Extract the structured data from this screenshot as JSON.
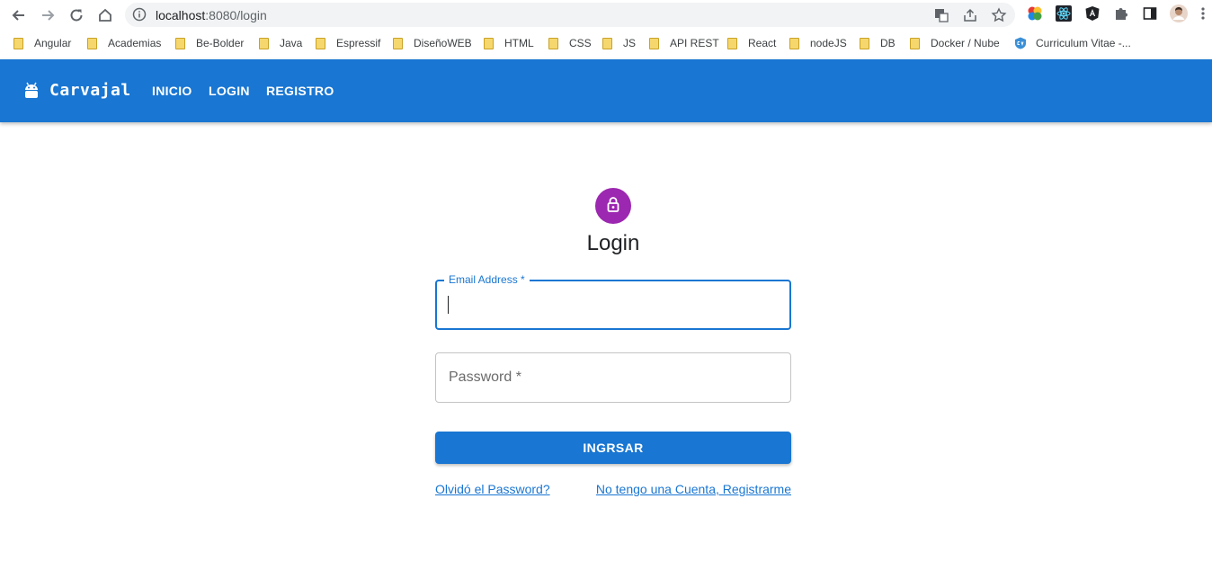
{
  "browser": {
    "url_host": "localhost",
    "url_rest": ":8080/login",
    "bookmarks": [
      {
        "label": "Angular"
      },
      {
        "label": "Academias"
      },
      {
        "label": "Be-Bolder"
      },
      {
        "label": "Java"
      },
      {
        "label": "Espressif"
      },
      {
        "label": "DiseñoWEB"
      },
      {
        "label": "HTML"
      },
      {
        "label": "CSS"
      },
      {
        "label": "JS"
      },
      {
        "label": "API REST"
      },
      {
        "label": "React"
      },
      {
        "label": "nodeJS"
      },
      {
        "label": "DB"
      },
      {
        "label": "Docker / Nube"
      },
      {
        "label": "Curriculum Vitae -..."
      }
    ]
  },
  "app": {
    "brand": "Carvajal",
    "nav": [
      {
        "label": "INICIO"
      },
      {
        "label": "LOGIN"
      },
      {
        "label": "REGISTRO"
      }
    ]
  },
  "login": {
    "title": "Login",
    "email_label": "Email Address *",
    "email_value": "",
    "password_placeholder": "Password *",
    "submit_label": "INGRSAR",
    "forgot_link": "Olvidó el Password?",
    "register_link": "No tengo una Cuenta, Registrarme"
  },
  "colors": {
    "primary": "#1976d2",
    "avatar": "#9c27b0"
  }
}
